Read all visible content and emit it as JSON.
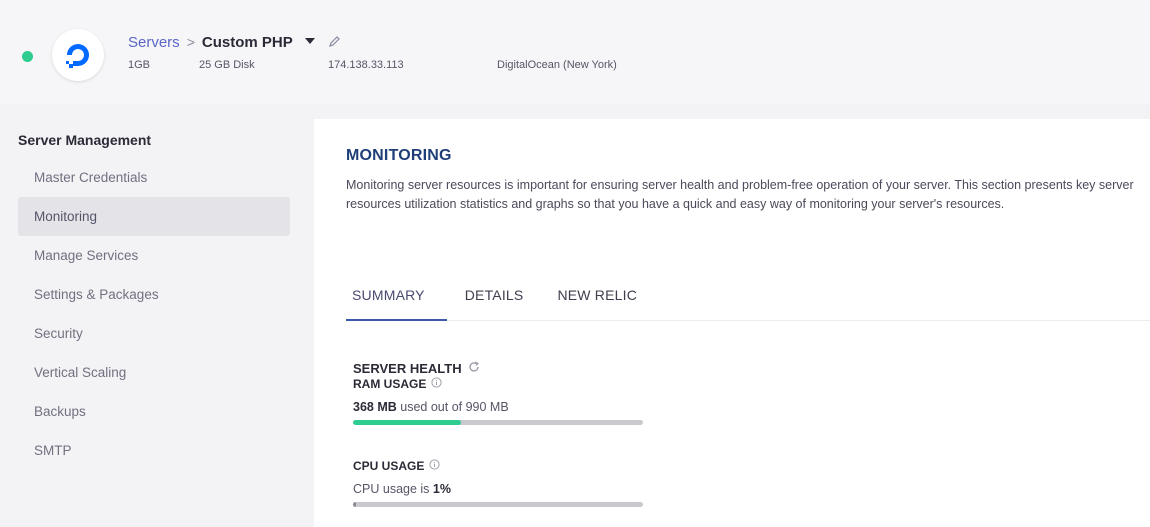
{
  "header": {
    "breadcrumb_parent": "Servers",
    "breadcrumb_sep": ">",
    "server_name": "Custom PHP",
    "meta": {
      "ram": "1GB",
      "disk": "25 GB Disk",
      "ip": "174.138.33.113",
      "provider": "DigitalOcean (New York)"
    },
    "status_color": "#2ecc8e"
  },
  "sidebar": {
    "heading": "Server Management",
    "items": [
      {
        "label": "Master Credentials"
      },
      {
        "label": "Monitoring",
        "active": true
      },
      {
        "label": "Manage Services"
      },
      {
        "label": "Settings & Packages"
      },
      {
        "label": "Security"
      },
      {
        "label": "Vertical Scaling"
      },
      {
        "label": "Backups"
      },
      {
        "label": "SMTP"
      }
    ]
  },
  "main": {
    "title": "MONITORING",
    "description": "Monitoring server resources is important for ensuring server health and problem-free operation of your server. This section presents key server resources utilization statistics and graphs so that you have a quick and easy way of monitoring your server's resources.",
    "tabs": [
      {
        "label": "SUMMARY",
        "active": true
      },
      {
        "label": "DETAILS"
      },
      {
        "label": "NEW RELIC"
      }
    ],
    "health_title": "SERVER HEALTH",
    "ram": {
      "label": "RAM USAGE",
      "used_value": "368 MB",
      "used_suffix": "used out of 990 MB",
      "fraction": 0.372,
      "color": "#2ecc8e"
    },
    "cpu": {
      "label": "CPU USAGE",
      "prefix": "CPU usage is",
      "value": "1%",
      "fraction": 0.01,
      "color": "#8a8a95"
    }
  }
}
